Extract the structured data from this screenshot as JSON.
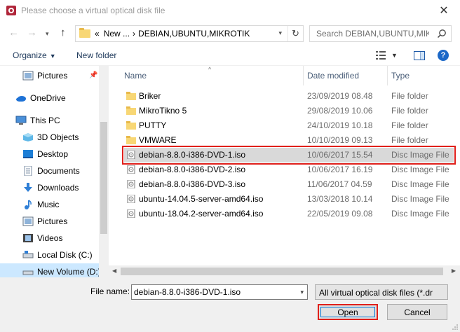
{
  "window": {
    "title": "Please choose a virtual optical disk file"
  },
  "navigation": {
    "back_icon": "arrow-left-icon",
    "forward_icon": "arrow-right-icon",
    "recent_icon": "chevron-down-icon",
    "up_icon": "arrow-up-icon",
    "address": {
      "overflow": "«",
      "parent": "New ...",
      "separator": "›",
      "current": "DEBIAN,UBUNTU,MIKROTIK"
    },
    "search_placeholder": "Search DEBIAN,UBUNTU,MIK..."
  },
  "toolbar": {
    "organize_label": "Organize",
    "new_folder_label": "New folder",
    "help_label": "?"
  },
  "sidebar": {
    "items": [
      {
        "label": "Pictures",
        "icon": "pictures-icon"
      },
      {
        "label": "OneDrive",
        "icon": "onedrive-icon"
      },
      {
        "label": "This PC",
        "icon": "this-pc-icon"
      },
      {
        "label": "3D Objects",
        "icon": "3d-objects-icon"
      },
      {
        "label": "Desktop",
        "icon": "desktop-icon"
      },
      {
        "label": "Documents",
        "icon": "documents-icon"
      },
      {
        "label": "Downloads",
        "icon": "downloads-icon"
      },
      {
        "label": "Music",
        "icon": "music-icon"
      },
      {
        "label": "Pictures",
        "icon": "pictures-icon"
      },
      {
        "label": "Videos",
        "icon": "videos-icon"
      },
      {
        "label": "Local Disk (C:)",
        "icon": "drive-icon"
      },
      {
        "label": "New Volume (D:)",
        "icon": "drive-icon"
      }
    ]
  },
  "columns": {
    "name": "Name",
    "date": "Date modified",
    "type": "Type"
  },
  "files": [
    {
      "name": "Briker",
      "date": "23/09/2019 08.48",
      "type": "File folder",
      "kind": "folder"
    },
    {
      "name": "MikroTikno 5",
      "date": "29/08/2019 10.06",
      "type": "File folder",
      "kind": "folder"
    },
    {
      "name": "PUTTY",
      "date": "24/10/2019 10.18",
      "type": "File folder",
      "kind": "folder"
    },
    {
      "name": "VMWARE",
      "date": "10/10/2019 09.13",
      "type": "File folder",
      "kind": "folder"
    },
    {
      "name": "debian-8.8.0-i386-DVD-1.iso",
      "date": "10/06/2017 15.54",
      "type": "Disc Image File",
      "kind": "iso",
      "selected": true
    },
    {
      "name": "debian-8.8.0-i386-DVD-2.iso",
      "date": "10/06/2017 16.19",
      "type": "Disc Image File",
      "kind": "iso"
    },
    {
      "name": "debian-8.8.0-i386-DVD-3.iso",
      "date": "11/06/2017 04.59",
      "type": "Disc Image File",
      "kind": "iso"
    },
    {
      "name": "ubuntu-14.04.5-server-amd64.iso",
      "date": "13/03/2018 10.14",
      "type": "Disc Image File",
      "kind": "iso"
    },
    {
      "name": "ubuntu-18.04.2-server-amd64.iso",
      "date": "22/05/2019 09.08",
      "type": "Disc Image File",
      "kind": "iso"
    }
  ],
  "footer": {
    "file_name_label": "File name:",
    "file_name_value": "debian-8.8.0-i386-DVD-1.iso",
    "filter_value": "All virtual optical disk files (*.dr",
    "open_label": "Open",
    "cancel_label": "Cancel"
  },
  "colors": {
    "highlight": "#e0201b",
    "selection": "#d9d9d9",
    "sidebar_selected": "#cce8ff",
    "folder": "#f8d775",
    "accent": "#0078d7"
  }
}
